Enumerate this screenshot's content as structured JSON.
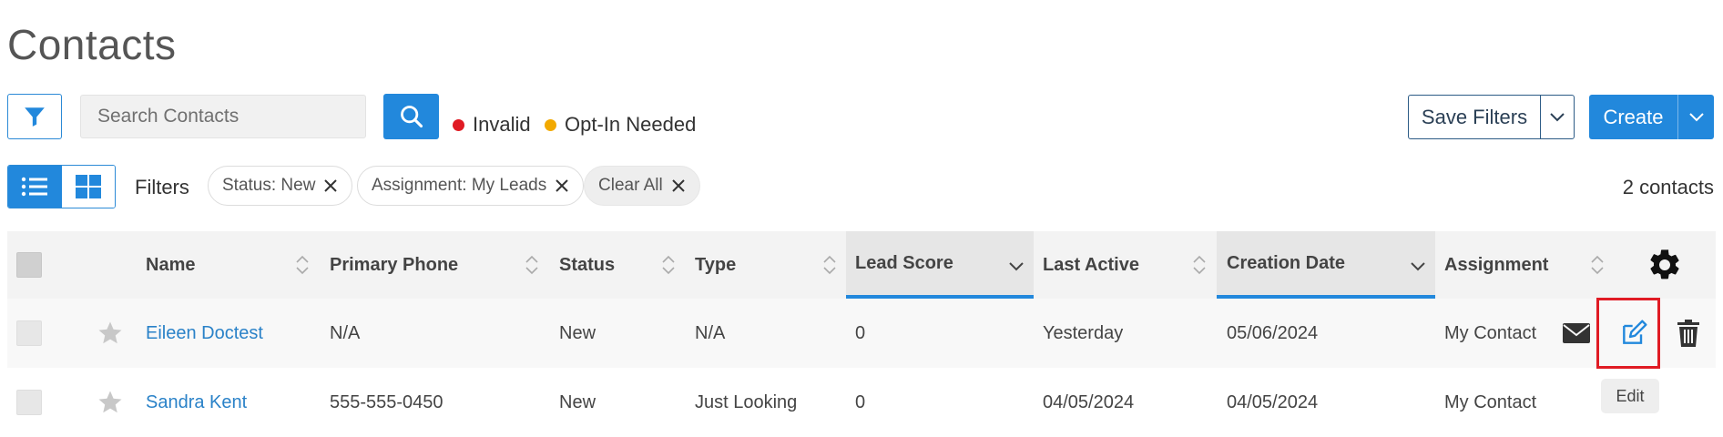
{
  "page": {
    "title": "Contacts"
  },
  "toolbar": {
    "search_placeholder": "Search Contacts",
    "legend": [
      {
        "label": "Invalid",
        "color": "#e01b24"
      },
      {
        "label": "Opt-In Needed",
        "color": "#f2a900"
      }
    ],
    "save_filters_label": "Save Filters",
    "create_label": "Create"
  },
  "filters": {
    "label": "Filters",
    "chips": [
      {
        "label": "Status: New"
      },
      {
        "label": "Assignment: My Leads"
      },
      {
        "label": "Clear All"
      }
    ],
    "count_text": "2 contacts"
  },
  "table": {
    "columns": [
      {
        "key": "name",
        "label": "Name",
        "sorted": false
      },
      {
        "key": "phone",
        "label": "Primary Phone",
        "sorted": false
      },
      {
        "key": "status",
        "label": "Status",
        "sorted": false
      },
      {
        "key": "type",
        "label": "Type",
        "sorted": false
      },
      {
        "key": "lead_score",
        "label": "Lead Score",
        "sorted": true
      },
      {
        "key": "last_active",
        "label": "Last Active",
        "sorted": false
      },
      {
        "key": "creation_date",
        "label": "Creation Date",
        "sorted": true
      },
      {
        "key": "assignment",
        "label": "Assignment",
        "sorted": false
      }
    ],
    "rows": [
      {
        "name": "Eileen Doctest",
        "phone": "N/A",
        "status": "New",
        "type": "N/A",
        "lead_score": "0",
        "last_active": "Yesterday",
        "creation_date": "05/06/2024",
        "assignment": "My Contact"
      },
      {
        "name": "Sandra Kent",
        "phone": "555-555-0450",
        "status": "New",
        "type": "Just Looking",
        "lead_score": "0",
        "last_active": "04/05/2024",
        "creation_date": "04/05/2024",
        "assignment": "My Contact"
      }
    ]
  },
  "tooltip": {
    "text": "Edit"
  },
  "icons": {
    "filter": "filter-icon",
    "search": "search-icon",
    "list_view": "list-view-icon",
    "grid_view": "grid-view-icon",
    "settings": "gear-icon",
    "star": "star-icon",
    "email": "envelope-icon",
    "edit": "edit-icon",
    "delete": "trash-icon"
  },
  "colors": {
    "accent": "#2288dc",
    "link": "#2a82c8",
    "highlight": "#e01b24"
  }
}
